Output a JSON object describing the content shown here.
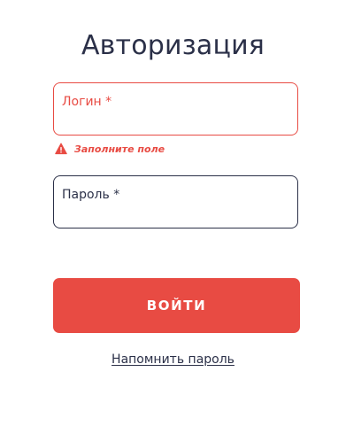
{
  "page": {
    "title": "Авторизация"
  },
  "form": {
    "login": {
      "label": "Логин *",
      "value": "",
      "error": "Заполните поле"
    },
    "password": {
      "label": "Пароль *",
      "value": ""
    },
    "submit_label": "ВОЙТИ",
    "remind_link": "Напомнить пароль"
  },
  "colors": {
    "accent": "#e84b43",
    "text": "#2b3048",
    "background": "#ffffff"
  },
  "icons": {
    "error": "warning-icon"
  }
}
